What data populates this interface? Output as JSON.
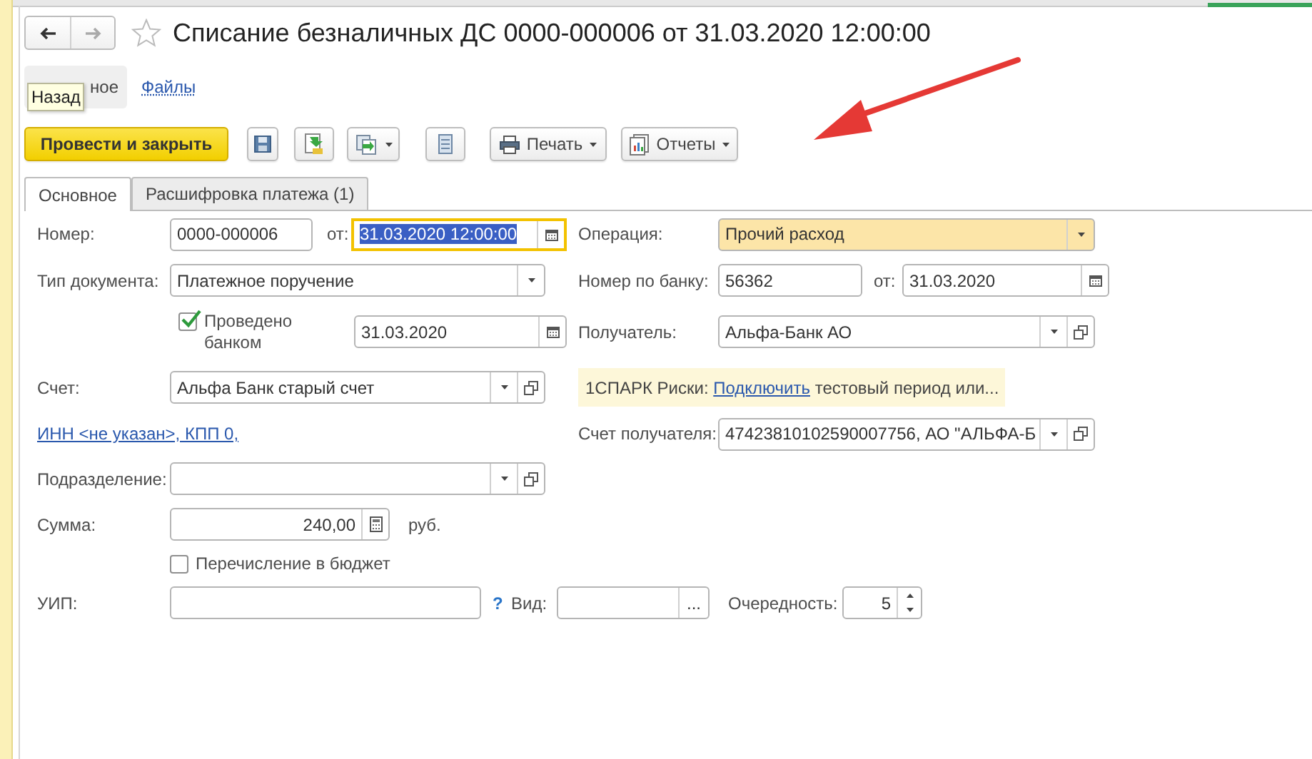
{
  "nav": {
    "back_disabled": false,
    "forward_disabled": true
  },
  "title": "Списание безналичных ДС 0000-000006 от 31.03.2020 12:00:00",
  "sections": [
    {
      "label": "ное",
      "selected": true
    },
    {
      "label": "Файлы",
      "selected": false
    }
  ],
  "tooltip": "Назад",
  "toolbar": [
    {
      "kind": "primary",
      "label": "Провести и закрыть"
    },
    {
      "kind": "icon"
    },
    {
      "kind": "icon"
    },
    {
      "kind": "icon-menu"
    },
    {
      "kind": "icon"
    },
    {
      "kind": "menu",
      "label": "Печать"
    },
    {
      "kind": "menu",
      "label": "Отчеты"
    }
  ],
  "tabs": [
    {
      "label": "Основное",
      "selected": true
    },
    {
      "label": "Расшифровка платежа (1)",
      "selected": false
    }
  ],
  "form": [
    {
      "items": [
        {
          "kind": "label",
          "text": "Номер:"
        },
        {
          "kind": "input",
          "value": "0000-000006"
        },
        {
          "kind": "label",
          "text": "от:"
        },
        {
          "kind": "date",
          "value": "31.03.2020 12:00:00",
          "focused": true
        },
        {
          "kind": "label",
          "text": "Операция:"
        },
        {
          "kind": "select",
          "value": "Прочий расход",
          "highlighted": true
        }
      ]
    },
    {
      "items": [
        {
          "kind": "label",
          "text": "Тип документа:"
        },
        {
          "kind": "select",
          "value": "Платежное поручение",
          "highlighted": false
        },
        {
          "kind": "label",
          "text": "Номер по банку:"
        },
        {
          "kind": "input",
          "value": "56362"
        },
        {
          "kind": "label",
          "text": "от:"
        },
        {
          "kind": "date",
          "value": "31.03.2020",
          "focused": false
        }
      ]
    },
    {
      "items": [
        {
          "kind": "checkbox",
          "text": "Проведено банком",
          "checked": true
        },
        {
          "kind": "date",
          "value": "31.03.2020",
          "focused": false
        },
        {
          "kind": "label",
          "text": "Получатель:"
        },
        {
          "kind": "combo",
          "value": "Альфа-Банк АО"
        }
      ]
    },
    {
      "items": [
        {
          "kind": "label",
          "text": "Счет:"
        },
        {
          "kind": "combo",
          "value": "Альфа Банк старый счет"
        },
        {
          "kind": "banner",
          "prefix": "1СПАРК Риски: ",
          "link": "Подключить",
          "suffix": " тестовый период или..."
        }
      ]
    },
    {
      "items": [
        {
          "kind": "link",
          "text": "ИНН <не указан>, КПП 0,"
        },
        {
          "kind": "label",
          "text": "Счет получателя:"
        },
        {
          "kind": "combo",
          "value": "47423810102590007756, АО \"АЛЬФА-Б"
        }
      ]
    },
    {
      "items": [
        {
          "kind": "label",
          "text": "Подразделение:"
        },
        {
          "kind": "combo",
          "value": ""
        }
      ]
    },
    {
      "items": [
        {
          "kind": "label",
          "text": "Сумма:"
        },
        {
          "kind": "calc",
          "value": "240,00"
        },
        {
          "kind": "unit",
          "text": "руб."
        }
      ]
    },
    {
      "items": [
        {
          "kind": "checkbox",
          "text": "Перечисление в бюджет",
          "checked": false
        }
      ]
    },
    {
      "items": [
        {
          "kind": "label",
          "text": "УИП:"
        },
        {
          "kind": "input",
          "value": ""
        },
        {
          "kind": "help",
          "text": "?"
        },
        {
          "kind": "label",
          "text": "Вид:"
        },
        {
          "kind": "choice",
          "value": "",
          "button_text": "..."
        },
        {
          "kind": "label",
          "text": "Очередность:"
        },
        {
          "kind": "spinner",
          "value": "5"
        }
      ]
    }
  ]
}
